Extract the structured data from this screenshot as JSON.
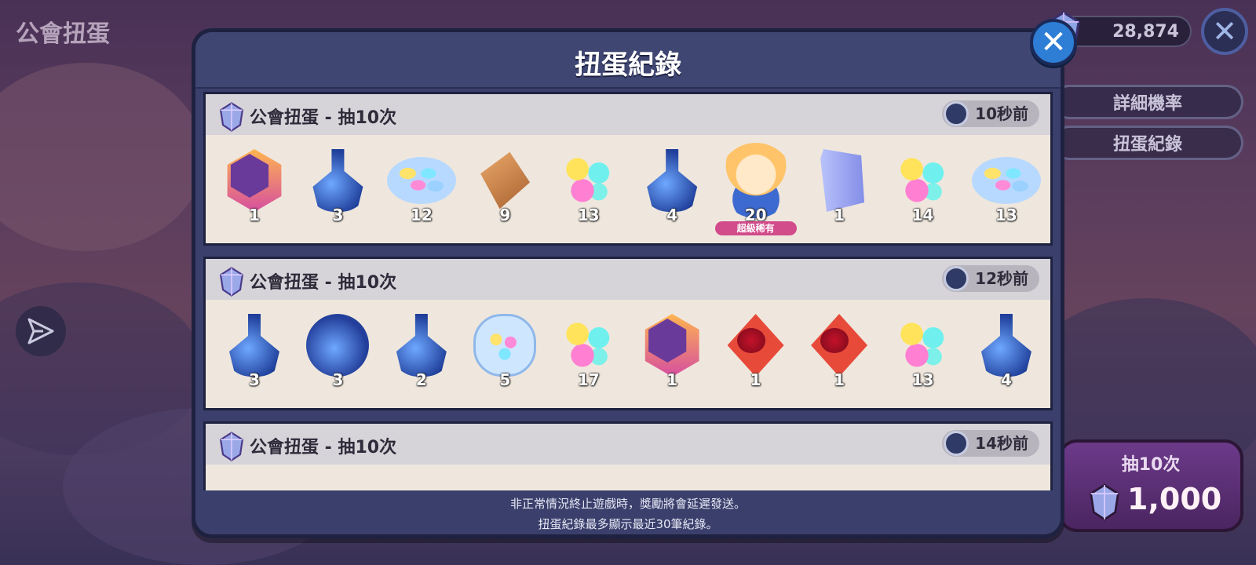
{
  "screen": {
    "title": "公會扭蛋",
    "currency_value": "28,874"
  },
  "side_buttons": {
    "details": "詳細機率",
    "history": "扭蛋紀錄"
  },
  "draw_button": {
    "label": "抽10次",
    "cost": "1,000"
  },
  "modal": {
    "title": "扭蛋紀錄",
    "records": [
      {
        "title": "公會扭蛋 - 抽10次",
        "time": "10秒前",
        "items": [
          {
            "icon": "medal-icon",
            "qty": "1"
          },
          {
            "icon": "potion-icon",
            "qty": "3"
          },
          {
            "icon": "candy-icon",
            "qty": "12"
          },
          {
            "icon": "diamond-icon",
            "qty": "9"
          },
          {
            "icon": "jelly-icon",
            "qty": "13"
          },
          {
            "icon": "potion-icon",
            "qty": "4"
          },
          {
            "icon": "cookie-icon",
            "qty": "20",
            "rarity": "超級稀有"
          },
          {
            "icon": "scroll-icon",
            "qty": "1"
          },
          {
            "icon": "jelly-icon",
            "qty": "14"
          },
          {
            "icon": "candy-icon",
            "qty": "13"
          }
        ]
      },
      {
        "title": "公會扭蛋 - 抽10次",
        "time": "12秒前",
        "items": [
          {
            "icon": "potion-icon",
            "qty": "3"
          },
          {
            "icon": "big-potion-icon",
            "qty": "3"
          },
          {
            "icon": "potion-icon",
            "qty": "2"
          },
          {
            "icon": "candy-bag-icon",
            "qty": "5"
          },
          {
            "icon": "jelly-icon",
            "qty": "17"
          },
          {
            "icon": "medal-icon",
            "qty": "1"
          },
          {
            "icon": "ruby-icon",
            "qty": "1"
          },
          {
            "icon": "ruby-icon",
            "qty": "1"
          },
          {
            "icon": "jelly-icon",
            "qty": "13"
          },
          {
            "icon": "potion-icon",
            "qty": "4"
          }
        ]
      },
      {
        "title": "公會扭蛋 - 抽10次",
        "time": "14秒前",
        "items": []
      }
    ],
    "footer_line1": "非正常情況終止遊戲時，獎勵將會延遲發送。",
    "footer_line2": "扭蛋紀錄最多顯示最近30筆紀錄。"
  },
  "colors": {
    "modal_bg": "#3a3f6b",
    "record_bg": "#efe7dd",
    "close_blue": "#2e7ed6",
    "draw_purple": "#6c3a8a"
  }
}
